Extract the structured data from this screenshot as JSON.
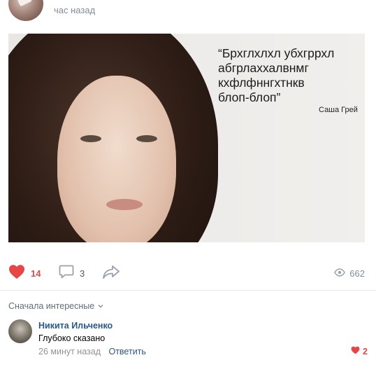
{
  "post": {
    "time": "час назад",
    "image": {
      "quote": "“Брхглхлхл убхгррхл\nабгрлаххалвнмг\nкхфлфннгхтнкв\nблоп-блоп”",
      "quote_author": "Саша Грей"
    },
    "actions": {
      "likes": "14",
      "comments": "3",
      "views": "662"
    }
  },
  "comments_section": {
    "sort_label": "Сначала интересные",
    "items": [
      {
        "author": "Никита Ильченко",
        "text": "Глубоко сказано",
        "time": "26 минут назад",
        "reply_label": "Ответить",
        "likes": "2"
      }
    ]
  },
  "colors": {
    "like_red": "#e64646",
    "link_blue": "#2a5885",
    "muted_gray": "#818c99"
  },
  "icons": [
    "heart-icon",
    "comment-icon",
    "share-icon",
    "eye-icon",
    "chevron-down-icon"
  ]
}
